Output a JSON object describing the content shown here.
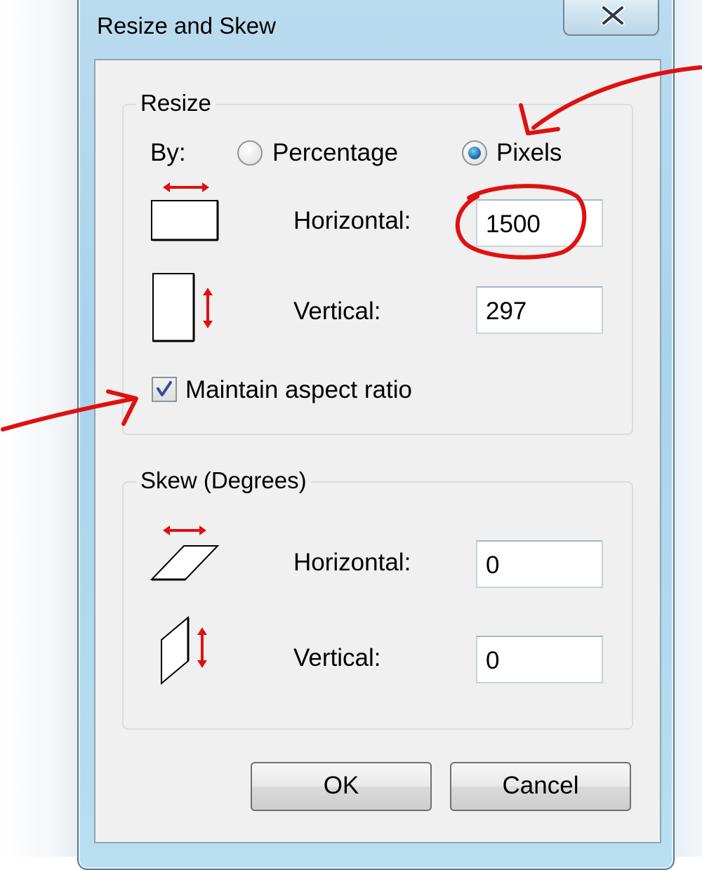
{
  "window": {
    "title": "Resize and Skew"
  },
  "resize": {
    "group_label": "Resize",
    "by_label": "By:",
    "percentage_label": "Percentage",
    "pixels_label": "Pixels",
    "selected_unit": "Pixels",
    "horizontal_label": "Horizontal:",
    "horizontal_value": "1500",
    "vertical_label": "Vertical:",
    "vertical_value": "297",
    "maintain_aspect_label": "Maintain aspect ratio",
    "maintain_aspect_checked": true
  },
  "skew": {
    "group_label": "Skew (Degrees)",
    "horizontal_label": "Horizontal:",
    "horizontal_value": "0",
    "vertical_label": "Vertical:",
    "vertical_value": "0"
  },
  "buttons": {
    "ok_label": "OK",
    "cancel_label": "Cancel"
  },
  "colors": {
    "annotation": "#e01010",
    "arrow_icon": "#e01010",
    "radio_accent": "#1c6fb0",
    "checkmark": "#3a4a9a"
  },
  "icons": [
    "close-icon",
    "resize-horizontal-icon",
    "resize-vertical-icon",
    "skew-horizontal-icon",
    "skew-vertical-icon",
    "checkmark-icon"
  ]
}
